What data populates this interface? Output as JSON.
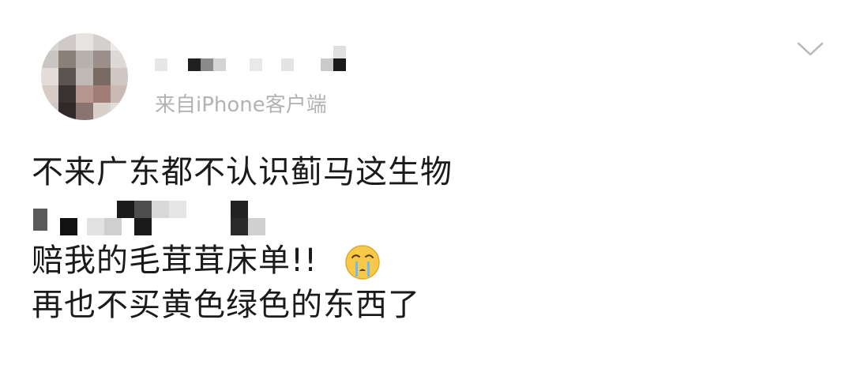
{
  "header": {
    "meta_client": "来自iPhone客户端"
  },
  "post": {
    "line1": "不来广东都不认识蓟马这生物",
    "line3": "赔我的毛茸茸床单!!",
    "line4": "再也不买黄色绿色的东西了"
  },
  "icons": {
    "menu": "chevron-down-icon",
    "emoji": "crying-face-emoji"
  },
  "colors": {
    "text": "#1a1a1a",
    "meta": "#b3b3b3",
    "background": "#ffffff"
  }
}
